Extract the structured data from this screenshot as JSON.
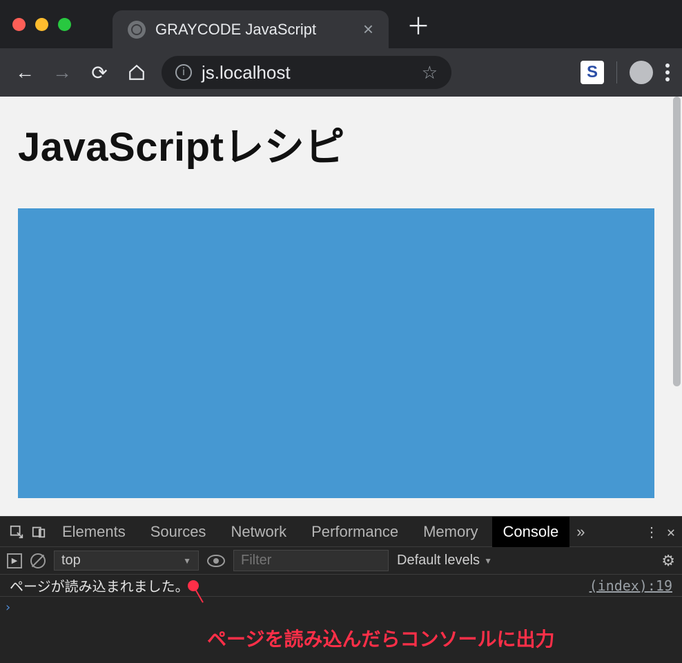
{
  "window": {
    "tab_title": "GRAYCODE JavaScript",
    "new_tab": "＋"
  },
  "toolbar": {
    "back": "←",
    "forward": "→",
    "reload": "⟳",
    "home": "⌂",
    "url": "js.localhost",
    "star": "☆",
    "ext_label": "S"
  },
  "page": {
    "heading": "JavaScriptレシピ"
  },
  "devtools": {
    "tabs": {
      "elements": "Elements",
      "sources": "Sources",
      "network": "Network",
      "performance": "Performance",
      "memory": "Memory",
      "console": "Console",
      "more": "»",
      "close": "✕",
      "kebab": "⋮"
    },
    "sub": {
      "context": "top",
      "context_caret": "▼",
      "filter_placeholder": "Filter",
      "levels": "Default levels",
      "levels_caret": "▼",
      "gear": "⚙"
    },
    "log": {
      "message": "ページが読み込まれました。",
      "source": "(index):19"
    },
    "prompt": "›"
  },
  "annotation": "ページを読み込んだらコンソールに出力"
}
